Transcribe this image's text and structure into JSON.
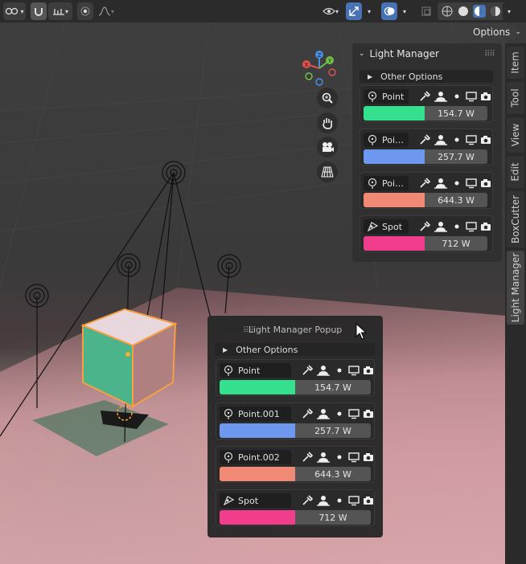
{
  "header": {
    "options_label": "Options"
  },
  "side_tabs": [
    {
      "label": "Item"
    },
    {
      "label": "Tool"
    },
    {
      "label": "View"
    },
    {
      "label": "Edit"
    },
    {
      "label": "BoxCutter"
    },
    {
      "label": "Light Manager"
    }
  ],
  "panel": {
    "title": "Light Manager",
    "other_options": "Other Options",
    "lights": [
      {
        "name": "Point",
        "power": "154.7 W",
        "color": "#34e08d",
        "icon": "point-light-icon"
      },
      {
        "name": "Poi…",
        "power": "257.7 W",
        "color": "#6e98ef",
        "icon": "point-light-icon"
      },
      {
        "name": "Poi…",
        "power": "644.3 W",
        "color": "#f18a74",
        "icon": "point-light-icon"
      },
      {
        "name": "Spot",
        "power": "712 W",
        "color": "#f03e8c",
        "icon": "spot-light-icon"
      }
    ]
  },
  "popup": {
    "title": "Light Manager Popup",
    "other_options": "Other Options",
    "lights": [
      {
        "name": "Point",
        "power": "154.7 W",
        "color": "#34e08d",
        "icon": "point-light-icon"
      },
      {
        "name": "Point.001",
        "power": "257.7 W",
        "color": "#6e98ef",
        "icon": "point-light-icon"
      },
      {
        "name": "Point.002",
        "power": "644.3 W",
        "color": "#f18a74",
        "icon": "point-light-icon"
      },
      {
        "name": "Spot",
        "power": "712 W",
        "color": "#f03e8c",
        "icon": "spot-light-icon"
      }
    ]
  },
  "gizmo": {
    "axis_labels": {
      "x": "X",
      "y": "Y",
      "z": "Z"
    }
  }
}
